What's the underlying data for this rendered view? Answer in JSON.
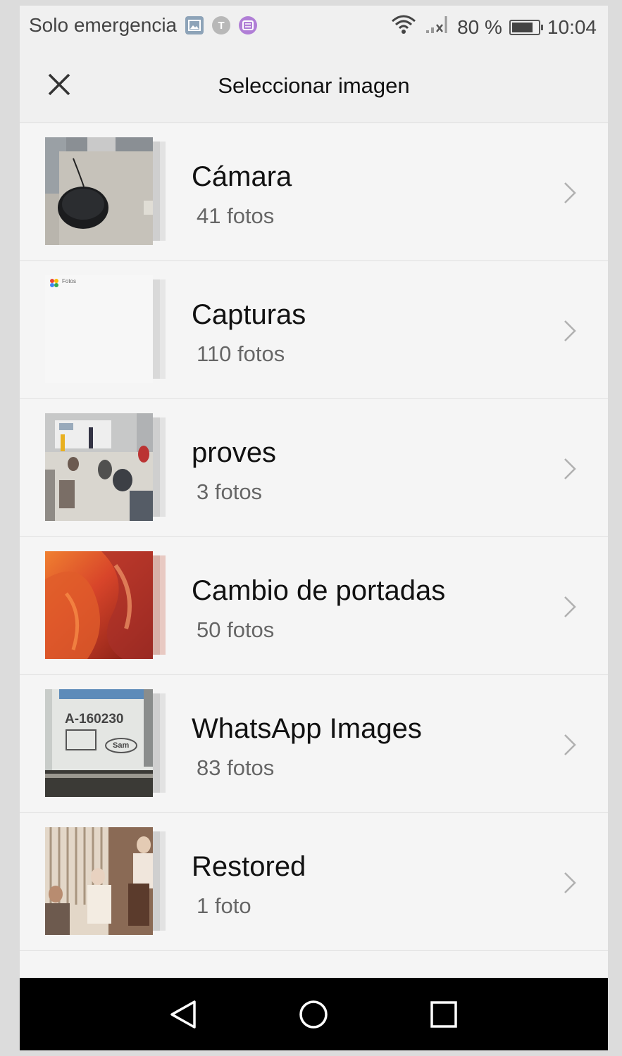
{
  "status_bar": {
    "carrier": "Solo emergencia",
    "battery_text": "80 %",
    "battery_level": 0.8,
    "time": "10:04",
    "icons": [
      "image-notification-icon",
      "t-notification-icon",
      "message-notification-icon",
      "wifi-icon",
      "signal-icon",
      "battery-icon"
    ]
  },
  "header": {
    "title": "Seleccionar imagen",
    "close_icon": "close-icon"
  },
  "albums": [
    {
      "name": "Cámara",
      "count": "41 fotos"
    },
    {
      "name": "Capturas",
      "count": "110 fotos"
    },
    {
      "name": "proves",
      "count": "3 fotos"
    },
    {
      "name": "Cambio de portadas",
      "count": "50 fotos"
    },
    {
      "name": "WhatsApp Images",
      "count": "83 fotos"
    },
    {
      "name": "Restored",
      "count": "1 foto"
    }
  ],
  "thumbnail_texts": {
    "capturas_logo": "Fotos",
    "whatsapp_code": "A-160230",
    "whatsapp_brand": "Sam"
  },
  "nav_bar": {
    "buttons": [
      "back-icon",
      "home-icon",
      "recents-icon"
    ]
  }
}
